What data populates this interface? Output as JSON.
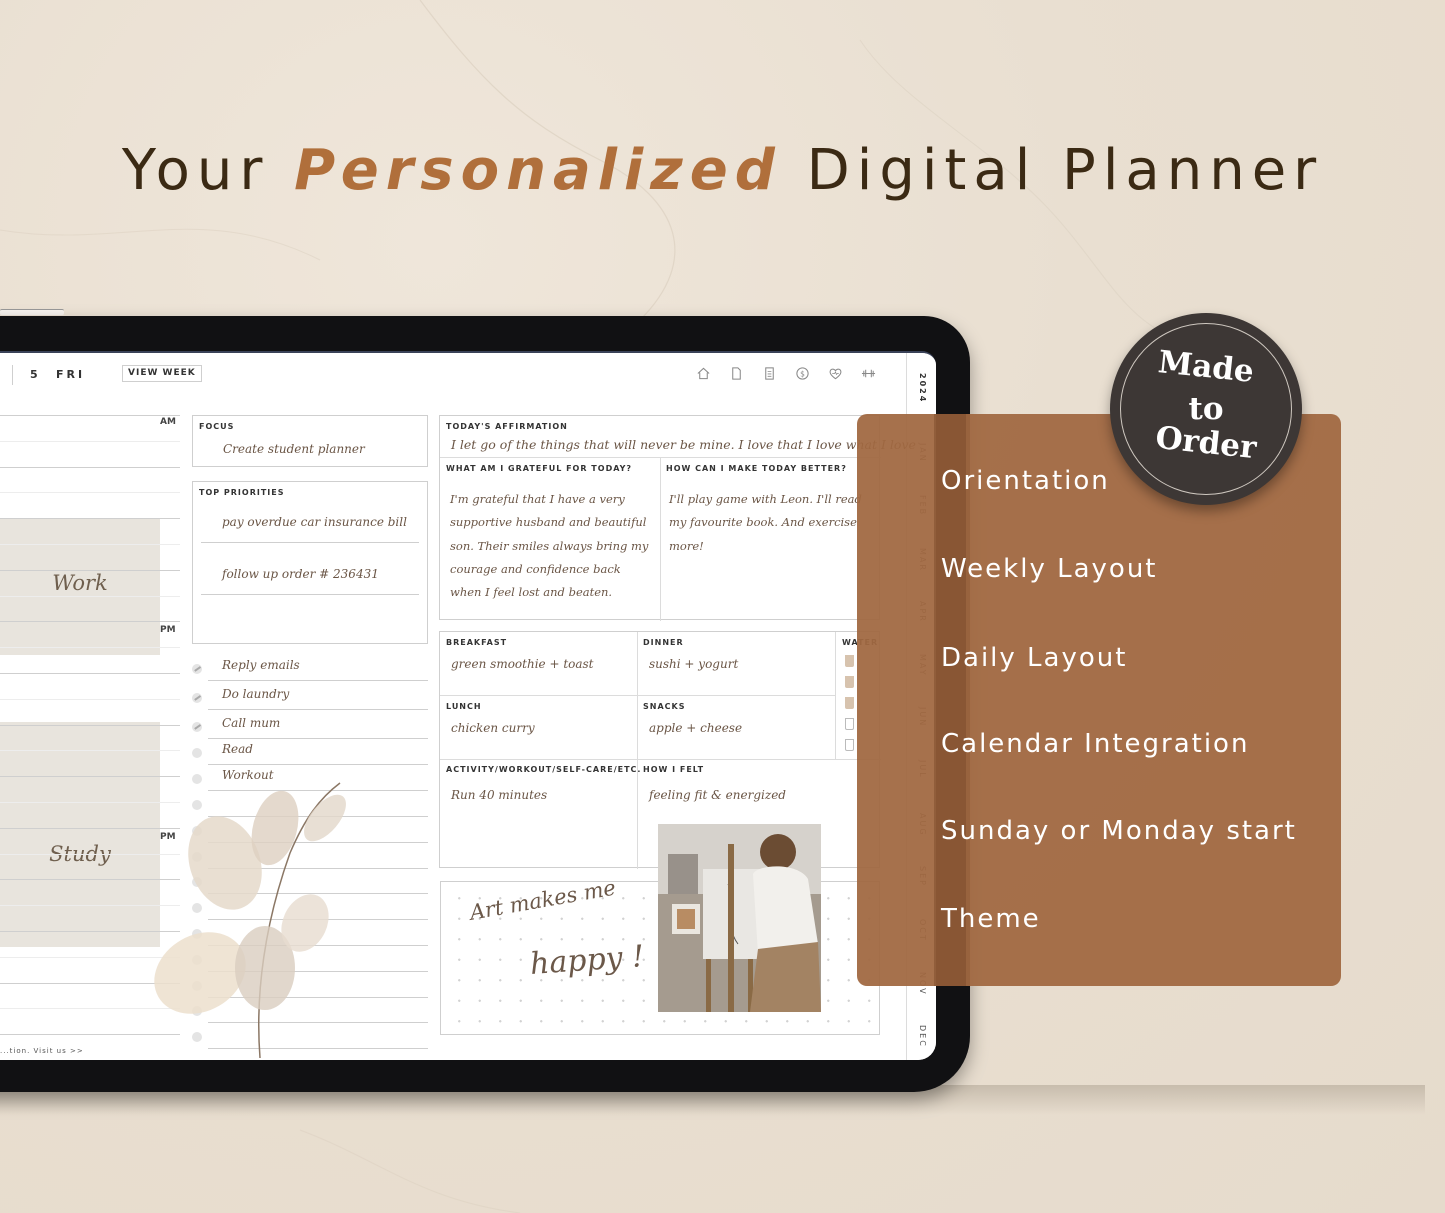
{
  "headline": {
    "prefix": "Your",
    "accent": "Personalized",
    "suffix": "Digital Planner",
    "accent_color": "#b06f3b",
    "text_color": "#3b2a14"
  },
  "planner": {
    "date_number": "5",
    "day": "FRI",
    "view_week_label": "VIEW WEEK",
    "nav_icons": [
      "home-icon",
      "page-icon",
      "notes-icon",
      "dollar-icon",
      "heart-icon",
      "dumbbell-icon"
    ],
    "year": "2024",
    "months": [
      "JAN",
      "FEB",
      "MAR",
      "APR",
      "MAY",
      "JUN",
      "JUL",
      "AUG",
      "SEP",
      "OCT",
      "NOV",
      "DEC"
    ],
    "schedule": {
      "am_label": "AM",
      "pm_label": "PM",
      "blocks": [
        {
          "label": "Work"
        },
        {
          "label": "Study"
        }
      ]
    },
    "footer": "...tion.   Visit us >>",
    "focus": {
      "label": "FOCUS",
      "value": "Create student planner"
    },
    "top_priorities": {
      "label": "TOP PRIORITIES",
      "items": [
        "pay overdue car insurance bill",
        "follow up order # 236431",
        ""
      ]
    },
    "todos": [
      {
        "text": "Reply emails",
        "done": true
      },
      {
        "text": "Do laundry",
        "done": true
      },
      {
        "text": "Call mum",
        "done": true
      },
      {
        "text": "Read",
        "done": false
      },
      {
        "text": "Workout",
        "done": false
      }
    ],
    "affirmation": {
      "label": "TODAY'S AFFIRMATION",
      "value": "I let go of the things that will never be mine. I love that I love what I love"
    },
    "grateful": {
      "label": "WHAT AM I GRATEFUL FOR TODAY?",
      "value": "I'm grateful that I have a very supportive husband and beautiful son. Their smiles always bring my courage and confidence back when I feel lost and beaten."
    },
    "better": {
      "label": "HOW CAN I MAKE TODAY BETTER?",
      "value": "I'll play game with Leon. I'll read my favourite book. And exercise more!"
    },
    "meals": {
      "breakfast": {
        "label": "BREAKFAST",
        "value": "green smoothie + toast"
      },
      "dinner": {
        "label": "DINNER",
        "value": "sushi + yogurt"
      },
      "lunch": {
        "label": "LUNCH",
        "value": "chicken curry"
      },
      "snacks": {
        "label": "SNACKS",
        "value": "apple + cheese"
      }
    },
    "water": {
      "label": "WATER",
      "glasses_filled": 3,
      "glasses_total": 5
    },
    "activity": {
      "label": "ACTIVITY/WORKOUT/SELF-CARE/ETC.",
      "value": "Run 40 minutes"
    },
    "felt": {
      "label": "HOW I FELT",
      "value": "feeling fit & energized"
    },
    "art_quote": {
      "line1": "Art makes me",
      "line2": "happy !"
    }
  },
  "badge": {
    "line1": "Made",
    "line2": "to",
    "line3": "Order"
  },
  "features": {
    "color": "#a06841",
    "items": [
      "Orientation",
      "Weekly Layout",
      "Daily Layout",
      "Calendar Integration",
      "Sunday or Monday start",
      "Theme"
    ]
  }
}
